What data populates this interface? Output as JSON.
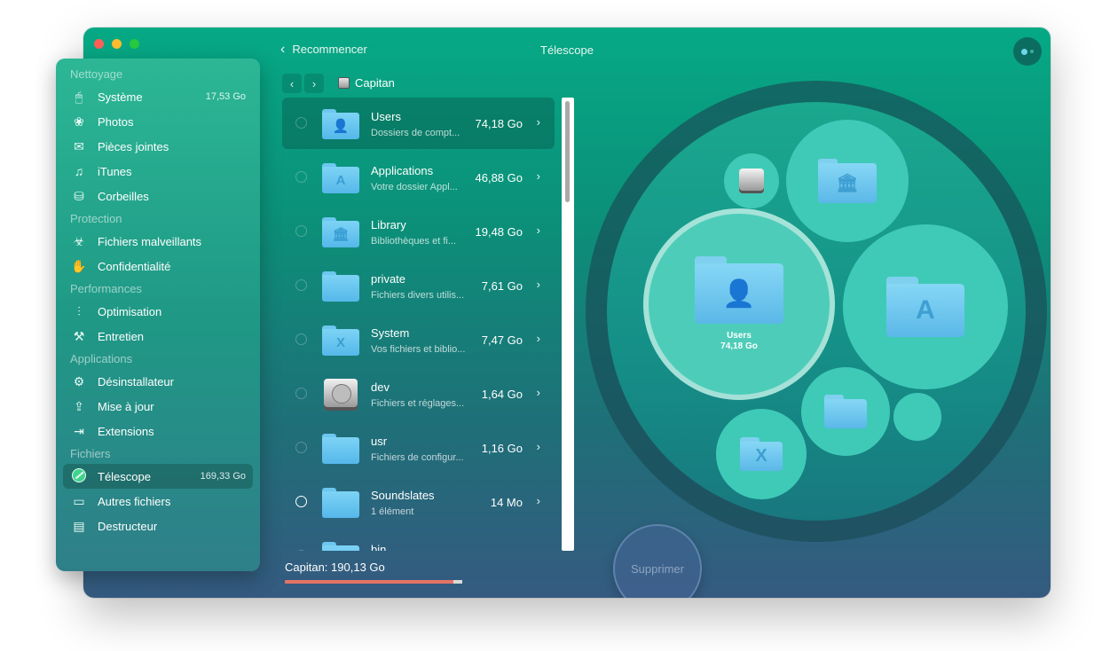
{
  "window": {
    "title": "Télescope",
    "back_label": "Recommencer"
  },
  "sidebar": {
    "sections": [
      {
        "header": "Nettoyage",
        "items": [
          {
            "label": "Système",
            "value": "17,53 Go",
            "icon": "system-icon"
          },
          {
            "label": "Photos",
            "value": "",
            "icon": "photos-icon"
          },
          {
            "label": "Pièces jointes",
            "value": "",
            "icon": "mail-attachments-icon"
          },
          {
            "label": "iTunes",
            "value": "",
            "icon": "music-note-icon"
          },
          {
            "label": "Corbeilles",
            "value": "",
            "icon": "trash-icon"
          }
        ]
      },
      {
        "header": "Protection",
        "items": [
          {
            "label": "Fichiers malveillants",
            "value": "",
            "icon": "biohazard-icon"
          },
          {
            "label": "Confidentialité",
            "value": "",
            "icon": "hand-icon"
          }
        ]
      },
      {
        "header": "Performances",
        "items": [
          {
            "label": "Optimisation",
            "value": "",
            "icon": "sliders-icon"
          },
          {
            "label": "Entretien",
            "value": "",
            "icon": "wrench-icon"
          }
        ]
      },
      {
        "header": "Applications",
        "items": [
          {
            "label": "Désinstallateur",
            "value": "",
            "icon": "uninstaller-icon"
          },
          {
            "label": "Mise à jour",
            "value": "",
            "icon": "update-icon"
          },
          {
            "label": "Extensions",
            "value": "",
            "icon": "extensions-icon"
          }
        ]
      },
      {
        "header": "Fichiers",
        "items": [
          {
            "label": "Télescope",
            "value": "169,33 Go",
            "icon": "telescope-icon",
            "active": true
          },
          {
            "label": "Autres fichiers",
            "value": "",
            "icon": "folder-icon"
          },
          {
            "label": "Destructeur",
            "value": "",
            "icon": "shredder-icon"
          }
        ]
      }
    ]
  },
  "browser": {
    "breadcrumb": "Capitan",
    "rows": [
      {
        "name": "Users",
        "sub": "Dossiers de compt...",
        "size": "74,18 Go",
        "icon": "users-folder-icon",
        "glyph": "👤",
        "selected": true
      },
      {
        "name": "Applications",
        "sub": "Votre dossier Appl...",
        "size": "46,88 Go",
        "icon": "applications-folder-icon",
        "glyph": "A"
      },
      {
        "name": "Library",
        "sub": "Bibliothèques et fi...",
        "size": "19,48 Go",
        "icon": "library-folder-icon",
        "glyph": "🏛"
      },
      {
        "name": "private",
        "sub": "Fichiers divers utilis...",
        "size": "7,61 Go",
        "icon": "folder-icon",
        "glyph": ""
      },
      {
        "name": "System",
        "sub": "Vos fichiers et biblio...",
        "size": "7,47 Go",
        "icon": "system-folder-icon",
        "glyph": "X"
      },
      {
        "name": "dev",
        "sub": "Fichiers et réglages...",
        "size": "1,64 Go",
        "icon": "hard-drive-icon",
        "glyph": ""
      },
      {
        "name": "usr",
        "sub": "Fichiers de configur...",
        "size": "1,16 Go",
        "icon": "folder-icon",
        "glyph": ""
      },
      {
        "name": "Soundslates",
        "sub": "1 élément",
        "size": "14 Mo",
        "icon": "folder-icon",
        "glyph": ""
      },
      {
        "name": "bin",
        "sub": "",
        "size": "",
        "icon": "folder-icon",
        "glyph": ""
      }
    ],
    "footer_label": "Capitan: 190,13 Go",
    "footer_used_fraction": 0.95
  },
  "viz": {
    "users_label": "Users",
    "users_size": "74,18 Go"
  },
  "delete_button": "Supprimer",
  "colors": {
    "accent": "#06a985",
    "disk_bar": "#e57366"
  }
}
